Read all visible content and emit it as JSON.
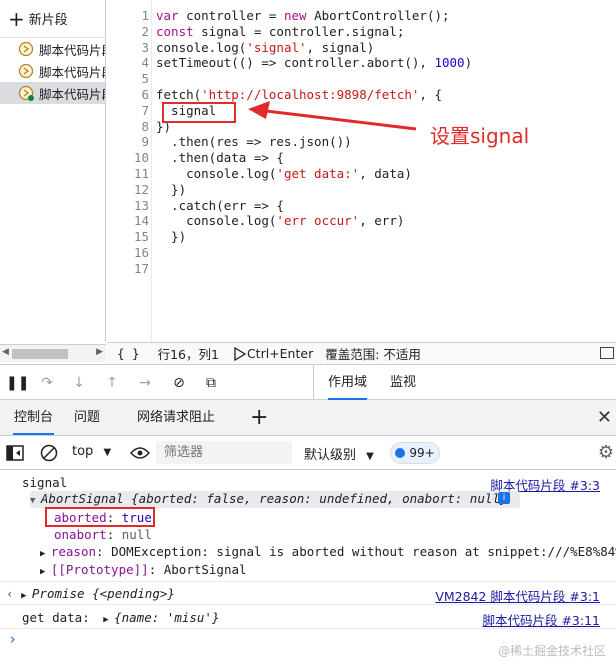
{
  "sidebar": {
    "new_snippet": "新片段",
    "items": [
      "脚本代码片段",
      "脚本代码片段",
      "脚本代码片段"
    ]
  },
  "editor": {
    "line_numbers": [
      "1",
      "2",
      "3",
      "4",
      "5",
      "6",
      "7",
      "8",
      "9",
      "10",
      "11",
      "12",
      "13",
      "14",
      "15",
      "16",
      "17"
    ],
    "lines": [
      [
        {
          "t": "var ",
          "c": "kw"
        },
        {
          "t": "controller = ",
          "c": ""
        },
        {
          "t": "new ",
          "c": "kw"
        },
        {
          "t": "AbortController();",
          "c": ""
        }
      ],
      [
        {
          "t": "const ",
          "c": "kw"
        },
        {
          "t": "signal = controller.signal;",
          "c": ""
        }
      ],
      [
        {
          "t": "console.log(",
          "c": ""
        },
        {
          "t": "'signal'",
          "c": "str"
        },
        {
          "t": ", signal)",
          "c": ""
        }
      ],
      [
        {
          "t": "setTimeout(() => controller.abort(), ",
          "c": ""
        },
        {
          "t": "1000",
          "c": "num"
        },
        {
          "t": ")",
          "c": ""
        }
      ],
      [],
      [
        {
          "t": "fetch(",
          "c": ""
        },
        {
          "t": "'http://localhost:9898/fetch'",
          "c": "str"
        },
        {
          "t": ", {",
          "c": ""
        }
      ],
      [
        {
          "t": "  signal",
          "c": ""
        }
      ],
      [
        {
          "t": "})",
          "c": ""
        }
      ],
      [
        {
          "t": "  .then(res => res.json())",
          "c": ""
        }
      ],
      [
        {
          "t": "  .then(data => {",
          "c": ""
        }
      ],
      [
        {
          "t": "    console.log(",
          "c": ""
        },
        {
          "t": "'get data:'",
          "c": "str"
        },
        {
          "t": ", data)",
          "c": ""
        }
      ],
      [
        {
          "t": "  })",
          "c": ""
        }
      ],
      [
        {
          "t": "  .catch(err => {",
          "c": ""
        }
      ],
      [
        {
          "t": "    console.log(",
          "c": ""
        },
        {
          "t": "'err occur'",
          "c": "str"
        },
        {
          "t": ", err)",
          "c": ""
        }
      ],
      [
        {
          "t": "  })",
          "c": ""
        }
      ],
      [],
      []
    ],
    "annotation_label": "设置signal"
  },
  "statusbar": {
    "braces": "{ }",
    "position": "行16，列1",
    "run": "Ctrl+Enter",
    "coverage": "覆盖范围: 不适用"
  },
  "debugger": {
    "tab_scope": "作用域",
    "tab_watch": "监视"
  },
  "drawer": {
    "tab_console": "控制台",
    "tab_issues": "问题",
    "tab_network_blocking": "网络请求阻止",
    "add": "+",
    "close": "✕"
  },
  "console_toolbar": {
    "context": "top",
    "filter_placeholder": "筛选器",
    "levels": "默认级别",
    "issues_count": "99+"
  },
  "console": {
    "msg1_text": "signal",
    "msg1_src": "脚本代码片段 #3:3",
    "obj_preview": "AbortSignal {aborted: false, reason: undefined, onabort: null}",
    "prop_aborted_key": "aborted",
    "prop_aborted_val": "true",
    "prop_onabort_key": "onabort",
    "prop_onabort_val": "null",
    "prop_reason_key": "reason",
    "prop_reason_val": "DOMException: signal is aborted without reason at snippet:///%E8%84%9",
    "prop_proto_key": "[[Prototype]]",
    "prop_proto_val": "AbortSignal",
    "msg2_text": "Promise {<pending>}",
    "msg2_src": "VM2842 脚本代码片段 #3:1",
    "msg3_text": "get data:",
    "msg3_obj": "{name: 'misu'}",
    "msg3_src": "脚本代码片段 #3:11",
    "prompt": "›"
  },
  "watermark": "@稀土掘金技术社区",
  "colors": {
    "accent": "#1a73e8",
    "annotation": "#e32a2a",
    "string": "#c41a16",
    "keyword": "#aa0d91"
  }
}
